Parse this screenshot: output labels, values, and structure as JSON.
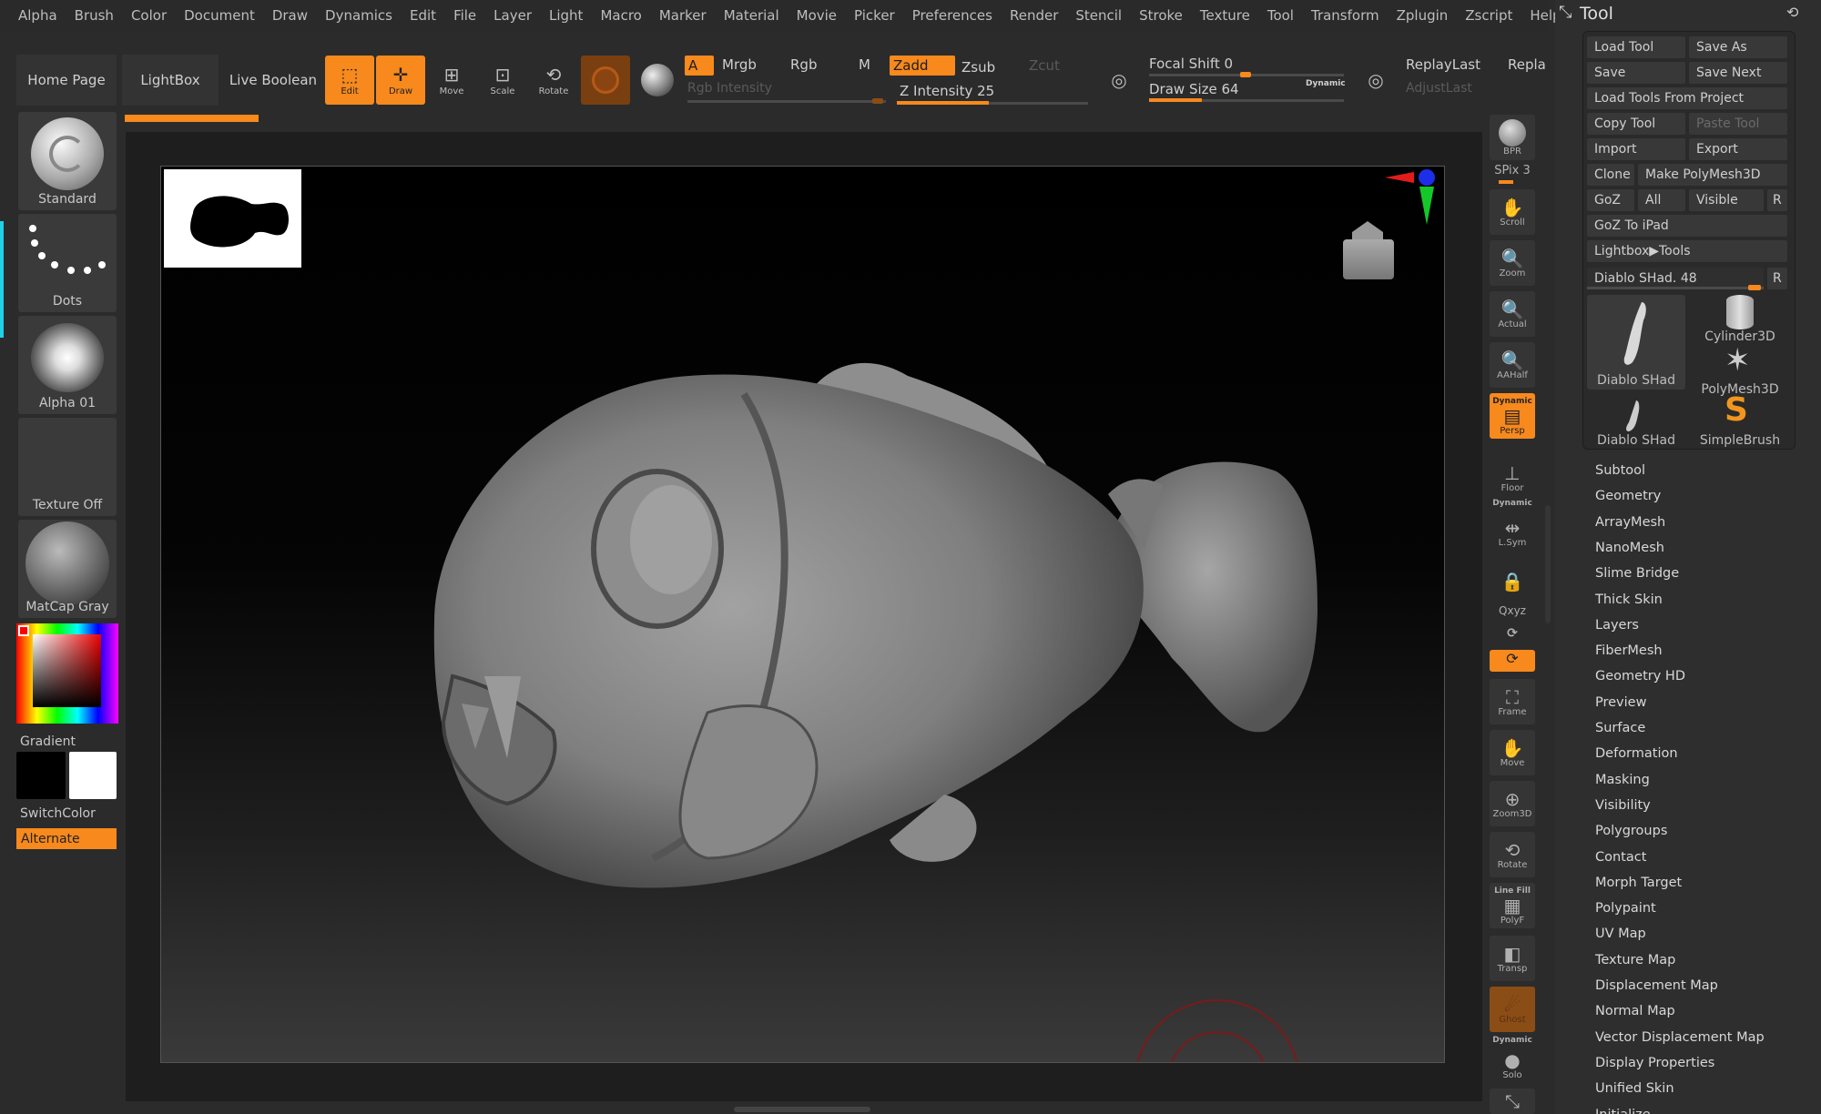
{
  "menu": [
    "Alpha",
    "Brush",
    "Color",
    "Document",
    "Draw",
    "Dynamics",
    "Edit",
    "File",
    "Layer",
    "Light",
    "Macro",
    "Marker",
    "Material",
    "Movie",
    "Picker",
    "Preferences",
    "Render",
    "Stencil",
    "Stroke",
    "Texture",
    "Tool",
    "Transform",
    "Zplugin",
    "Zscript",
    "Help"
  ],
  "nav": {
    "home": "Home Page",
    "lightbox": "LightBox",
    "live_boolean": "Live Boolean"
  },
  "modes": {
    "edit": "Edit",
    "draw": "Draw",
    "move": "Move",
    "scale": "Scale",
    "rotate": "Rotate"
  },
  "color_mode": {
    "a": "A",
    "mrgb": "Mrgb",
    "rgb": "Rgb",
    "m": "M",
    "rgb_intensity": "Rgb Intensity"
  },
  "z_mode": {
    "zadd": "Zadd",
    "zsub": "Zsub",
    "zcut": "Zcut",
    "z_intensity": "Z Intensity 25"
  },
  "draw": {
    "focal_shift": "Focal Shift 0",
    "draw_size": "Draw Size 64",
    "dynamic": "Dynamic"
  },
  "replay": {
    "last": "ReplayLast",
    "repl": "Repla",
    "adjust": "AdjustLast"
  },
  "left": {
    "brush": "Standard",
    "stroke": "Dots",
    "alpha": "Alpha 01",
    "texture": "Texture Off",
    "material": "MatCap Gray",
    "gradient": "Gradient",
    "switch": "SwitchColor",
    "alternate": "Alternate"
  },
  "shelf": {
    "bpr": "BPR",
    "spix": "SPix 3",
    "scroll": "Scroll",
    "zoom": "Zoom",
    "actual": "Actual",
    "aahalf": "AAHalf",
    "dynamic": "Dynamic",
    "persp": "Persp",
    "floor": "Floor",
    "lsym": "L.Sym",
    "xyz": "Qxyz",
    "frame": "Frame",
    "move": "Move",
    "zoom3d": "Zoom3D",
    "rotate": "Rotate",
    "linefill": "Line Fill",
    "polyf": "PolyF",
    "transp": "Transp",
    "ghost": "Ghost",
    "solo": "Solo"
  },
  "tool": {
    "title": "Tool",
    "buttons": {
      "load_tool": "Load Tool",
      "save_as": "Save As",
      "save": "Save",
      "save_next": "Save Next",
      "load_from_project": "Load Tools From Project",
      "copy_tool": "Copy Tool",
      "paste_tool": "Paste Tool",
      "import": "Import",
      "export": "Export",
      "clone": "Clone",
      "make_polymesh": "Make PolyMesh3D",
      "goz": "GoZ",
      "all": "All",
      "visible": "Visible",
      "r": "R",
      "goz_ipad": "GoZ To iPad",
      "lightbox_tools": "Lightbox▶Tools",
      "current_tool": "Diablo SHad. 48"
    },
    "thumbs": [
      "Diablo SHad",
      "Cylinder3D",
      "PolyMesh3D",
      "Diablo SHad",
      "SimpleBrush"
    ],
    "subpalettes": [
      "Subtool",
      "Geometry",
      "ArrayMesh",
      "NanoMesh",
      "Slime Bridge",
      "Thick Skin",
      "Layers",
      "FiberMesh",
      "Geometry HD",
      "Preview",
      "Surface",
      "Deformation",
      "Masking",
      "Visibility",
      "Polygroups",
      "Contact",
      "Morph Target",
      "Polypaint",
      "UV Map",
      "Texture Map",
      "Displacement Map",
      "Normal Map",
      "Vector Displacement Map",
      "Display Properties",
      "Unified Skin",
      "Initialize"
    ]
  },
  "colors": {
    "accent": "#f7891d",
    "panel": "#2b2b2b",
    "mesh": "#8c8c8c"
  }
}
